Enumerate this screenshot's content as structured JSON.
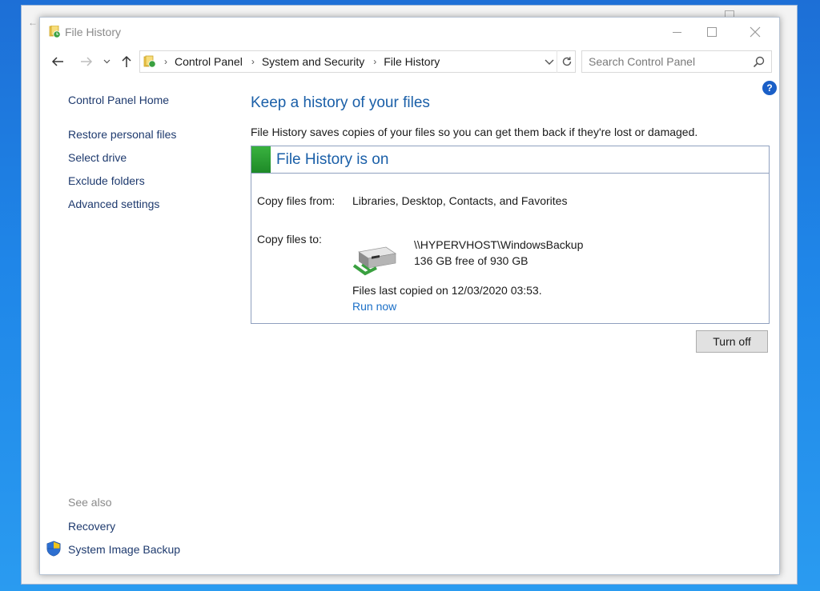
{
  "window": {
    "title": "File History",
    "controls": [
      "minimize",
      "maximize",
      "close"
    ]
  },
  "navigation": {
    "back_icon": "arrow-left-icon",
    "forward_icon": "arrow-right-icon",
    "recent_icon": "chevron-down-icon",
    "up_icon": "arrow-up-icon"
  },
  "address": {
    "breadcrumbs": [
      {
        "label": "Control Panel"
      },
      {
        "label": "System and Security"
      },
      {
        "label": "File History"
      }
    ],
    "dropdown_icon": "chevron-down-icon",
    "refresh_icon": "refresh-icon"
  },
  "search": {
    "placeholder": "Search Control Panel",
    "value": ""
  },
  "sidebar": {
    "home": "Control Panel Home",
    "items": [
      {
        "label": "Restore personal files"
      },
      {
        "label": "Select drive"
      },
      {
        "label": "Exclude folders"
      },
      {
        "label": "Advanced settings"
      }
    ],
    "see_also_label": "See also",
    "see_also": [
      {
        "label": "Recovery"
      },
      {
        "label": "System Image Backup",
        "icon": "shield-icon"
      }
    ]
  },
  "main": {
    "title": "Keep a history of your files",
    "description": "File History saves copies of your files so you can get them back if they're lost or damaged.",
    "status": {
      "title": "File History is on",
      "color": "#2ea236",
      "copy_from_label": "Copy files from:",
      "copy_from_value": "Libraries, Desktop, Contacts, and Favorites",
      "copy_to_label": "Copy files to:",
      "drive_name": "\\\\HYPERVHOST\\WindowsBackup",
      "drive_space": "136 GB free of 930 GB",
      "last_copied": "Files last copied on 12/03/2020 03:53.",
      "run_now": "Run now"
    },
    "turn_off_label": "Turn off"
  },
  "colors": {
    "link": "#1e3a6e",
    "heading": "#1a5fa8",
    "accent_link": "#1a6fc7"
  }
}
